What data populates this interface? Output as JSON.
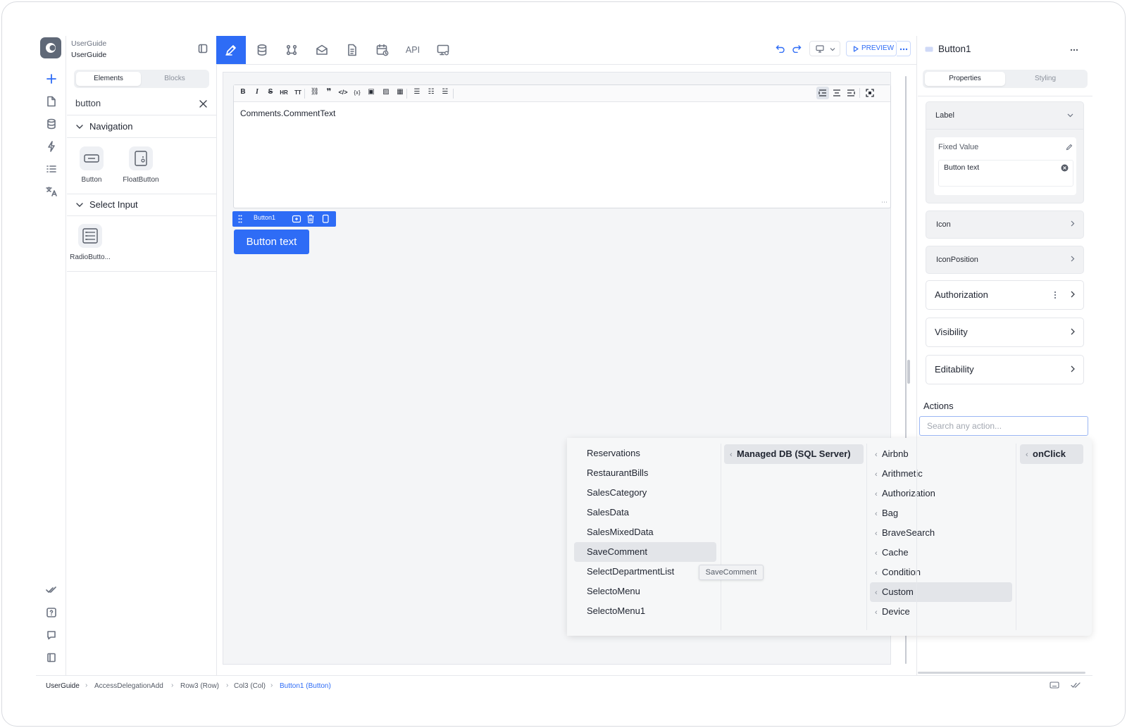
{
  "project": {
    "name": "UserGuide",
    "app": "UserGuide"
  },
  "panel": {
    "tabs": [
      "Elements",
      "Blocks"
    ],
    "search_value": "button",
    "groups": [
      {
        "title": "Navigation",
        "items": [
          "Button",
          "FloatButton"
        ]
      },
      {
        "title": "Select Input",
        "items": [
          "RadioButto..."
        ]
      }
    ]
  },
  "toolbar": {
    "api_label": "API",
    "preview_label": "PREVIEW"
  },
  "editor": {
    "content": "Comments.CommentText"
  },
  "selected": {
    "toolbar_label": "Button1",
    "button_text": "Button text"
  },
  "dropdown": {
    "col1": [
      "Reservations",
      "RestaurantBills",
      "SalesCategory",
      "SalesData",
      "SalesMixedData",
      "SaveComment",
      "SelectDepartmentList",
      "SelectoMenu",
      "SelectoMenu1"
    ],
    "col1_highlight": "SaveComment",
    "col2": [
      "Managed DB (SQL Server)"
    ],
    "col3": [
      "Airbnb",
      "Arithmetic",
      "Authorization",
      "Bag",
      "BraveSearch",
      "Cache",
      "Condition",
      "Custom",
      "Device"
    ],
    "col3_highlight": "Custom",
    "col4": [
      "onClick"
    ],
    "tooltip": "SaveComment"
  },
  "right_panel": {
    "title": "Button1",
    "tabs": [
      "Properties",
      "Styling"
    ],
    "label_section": "Label",
    "fixed_value_label": "Fixed Value",
    "fixed_value": "Button text",
    "sections": [
      "Icon",
      "IconPosition"
    ],
    "sections2": [
      "Authorization",
      "Visibility",
      "Editability"
    ],
    "actions_title": "Actions",
    "actions_placeholder": "Search any action..."
  },
  "breadcrumb": [
    "UserGuide",
    "AccessDelegationAdd",
    "Row3 (Row)",
    "Col3 (Col)",
    "Button1 (Button)"
  ],
  "colors": {
    "accent": "#2e6cf6",
    "highlight": "#e3e5e9"
  }
}
